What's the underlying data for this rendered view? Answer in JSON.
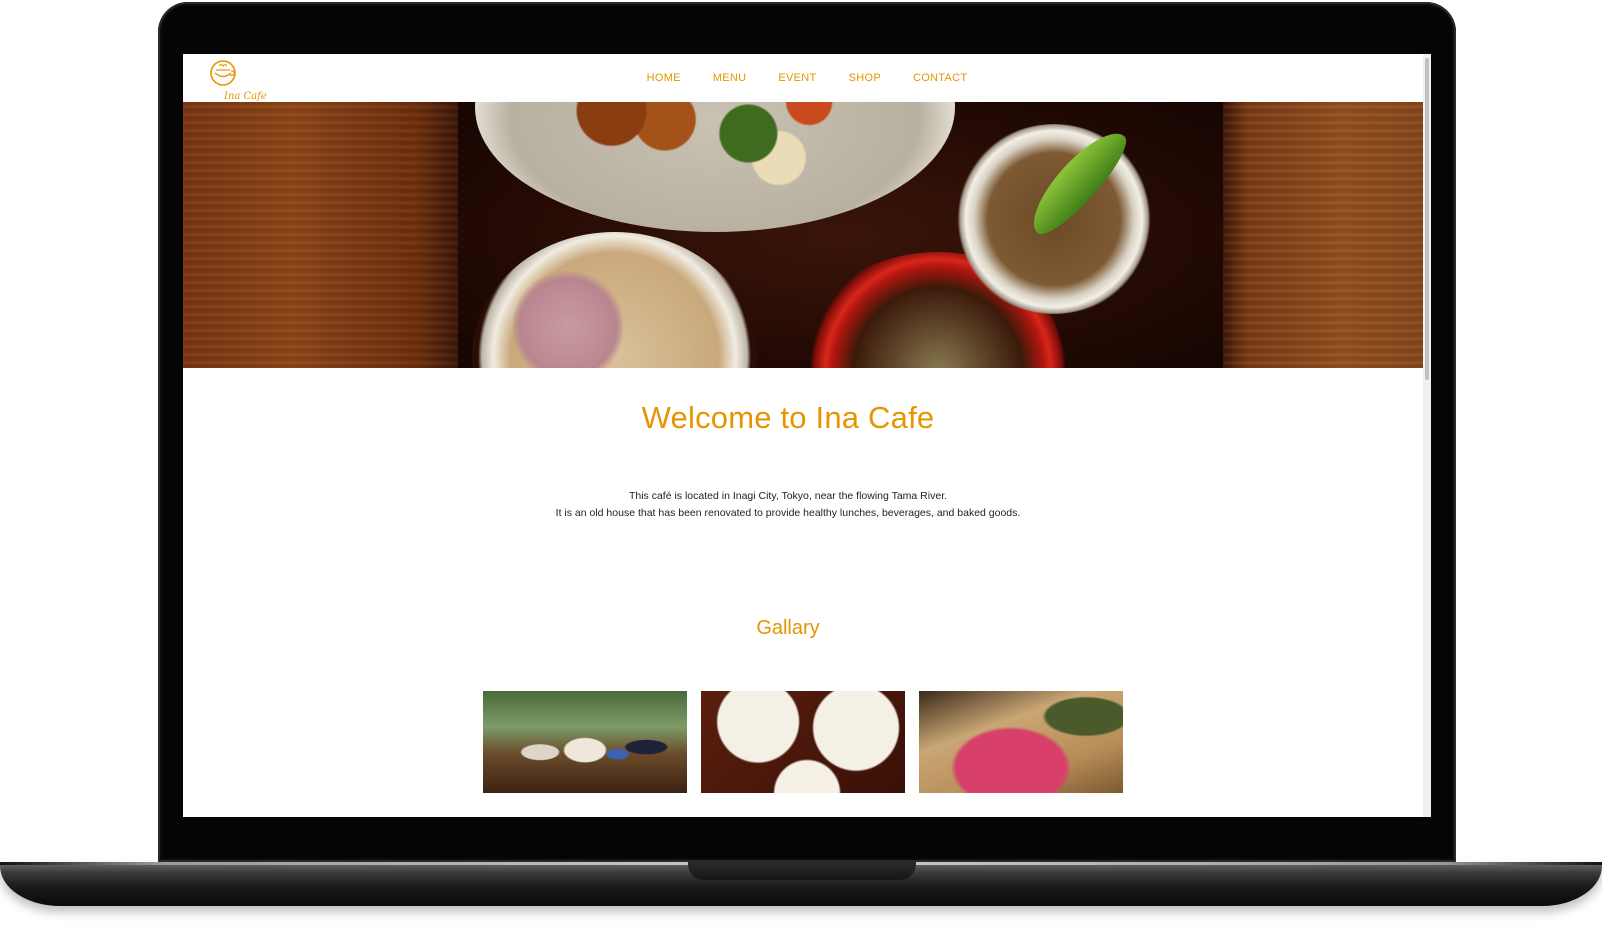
{
  "site": {
    "logo_text": "Ina Cafe",
    "brand_color": "#e69500"
  },
  "nav": {
    "items": [
      {
        "label": "HOME"
      },
      {
        "label": "MENU"
      },
      {
        "label": "EVENT"
      },
      {
        "label": "SHOP"
      },
      {
        "label": "CONTACT"
      }
    ]
  },
  "hero": {
    "image": "food-tray-photo"
  },
  "welcome": {
    "title": "Welcome to Ina Cafe",
    "lines": [
      "This café is located in Inagi City, Tokyo, near the flowing Tama River.",
      "It is an old house that has been renovated to provide healthy lunches, beverages, and baked goods."
    ]
  },
  "gallery": {
    "title": "Gallary",
    "images": [
      "gallery-photo-people",
      "gallery-photo-plates",
      "gallery-photo-radish"
    ]
  },
  "device": {
    "frame": "laptop"
  }
}
